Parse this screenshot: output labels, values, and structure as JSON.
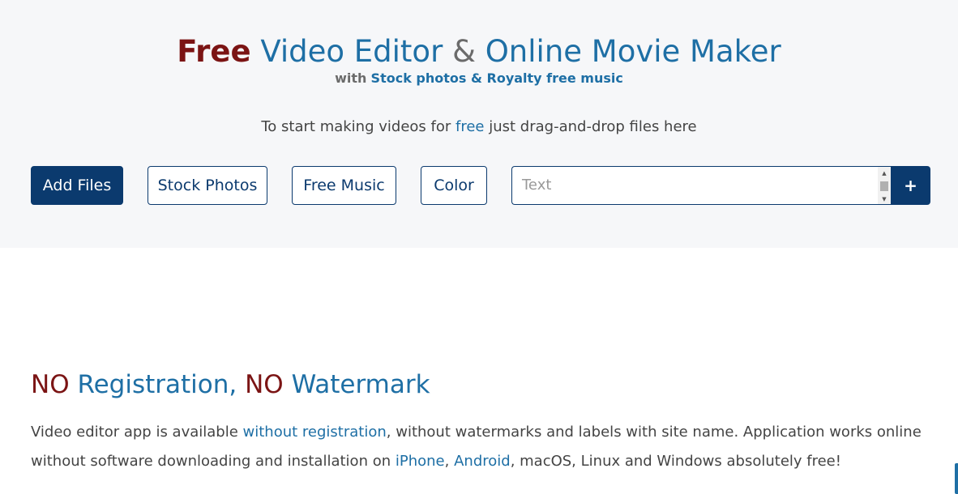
{
  "header": {
    "title_free": "Free",
    "title_video_editor": "Video Editor",
    "title_amp": "&",
    "title_online_movie_maker": "Online Movie Maker",
    "subtitle_with": "with",
    "subtitle_stock": "Stock photos & Royalty free music",
    "instruction_before": "To start making videos for",
    "instruction_link": "free",
    "instruction_after": "just drag-and-drop files here"
  },
  "toolbar": {
    "add_files_label": "Add Files",
    "stock_photos_label": "Stock Photos",
    "free_music_label": "Free Music",
    "color_label": "Color",
    "text_placeholder": "Text",
    "text_value": "",
    "add_text_label": "+"
  },
  "section": {
    "title_no_1": "NO",
    "title_registration": "Registration,",
    "title_no_2": "NO",
    "title_watermark": "Watermark",
    "p_part1": "Video editor app is available",
    "p_link1": "without registration",
    "p_part2": ", without watermarks and labels with site name. Application works online without software downloading and installation on",
    "p_link2": "iPhone",
    "p_sep1": ",",
    "p_link3": "Android",
    "p_part3": ", macOS, Linux and Windows absolutely free!"
  },
  "icons": {
    "scroll_up": "▲",
    "scroll_down": "▼"
  },
  "colors": {
    "accent_dark": "#0b3a6e",
    "accent_blue": "#1e6fa5",
    "accent_red": "#7b1414",
    "hero_background": "#f6f7f9"
  }
}
